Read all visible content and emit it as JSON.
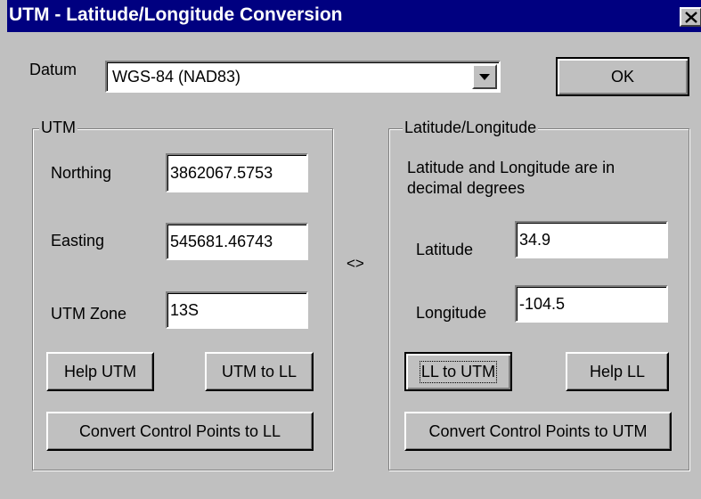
{
  "window": {
    "title": "UTM - Latitude/Longitude Conversion",
    "close_glyph": "✕"
  },
  "datum": {
    "label": "Datum",
    "selected": "WGS-84 (NAD83)",
    "arrow_glyph": "▼"
  },
  "ok_label": "OK",
  "utm_group": {
    "legend": "UTM",
    "northing_label": "Northing",
    "northing_value": "3862067.5753",
    "easting_label": "Easting",
    "easting_value": "545681.46743",
    "zone_label": "UTM Zone",
    "zone_value": "13S",
    "help_label": "Help UTM",
    "convert_label": "UTM to LL",
    "control_points_label": "Convert Control Points to LL"
  },
  "swap_glyph": "<>",
  "ll_group": {
    "legend": "Latitude/Longitude",
    "note_line1": "Latitude and Longitude are in",
    "note_line2": "decimal degrees",
    "latitude_label": "Latitude",
    "latitude_value": "34.9",
    "longitude_label": "Longitude",
    "longitude_value": "-104.5",
    "convert_label": "LL to UTM",
    "help_label": "Help LL",
    "control_points_label": "Convert Control Points to UTM"
  },
  "colors": {
    "face": "#c0c0c0",
    "titlebar": "#000080",
    "title_text": "#ffffff"
  }
}
